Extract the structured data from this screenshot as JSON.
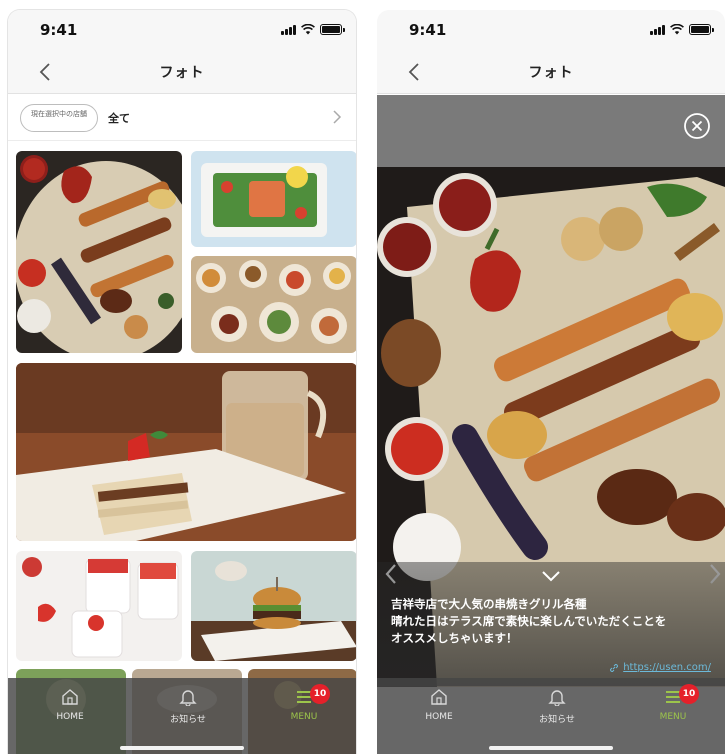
{
  "status_bar": {
    "time": "9:41"
  },
  "nav": {
    "title": "フォト"
  },
  "filter": {
    "store_label": "現在選択中の店舗",
    "value": "全て"
  },
  "tabs": [
    {
      "label": "HOME",
      "icon": "home-icon",
      "active": false
    },
    {
      "label": "お知らせ",
      "icon": "bell-icon",
      "active": false
    },
    {
      "label": "MENU",
      "icon": "menu-icon",
      "active": true
    }
  ],
  "menu_badge": "10",
  "viewer": {
    "caption_line1": "吉祥寺店で大人気の串焼きグリル各種",
    "caption_line2": "晴れた日はテラス席で素快に楽しんでいただくことを",
    "caption_line3": "オススメしちゃいます！",
    "link": "https://usen.com/"
  },
  "colors": {
    "accent_active": "#9cc44b",
    "badge": "#e5202a",
    "tabbar": "#464646",
    "link": "#6cb9d8"
  }
}
